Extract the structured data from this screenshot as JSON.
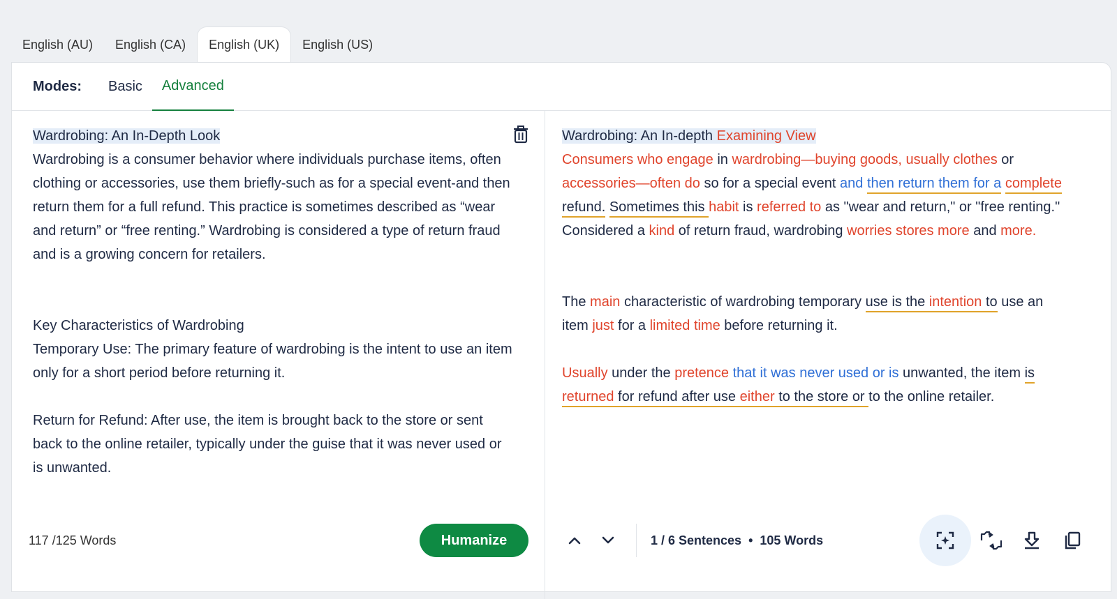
{
  "lang_tabs": [
    {
      "label": "English (AU)"
    },
    {
      "label": "English (CA)"
    },
    {
      "label": "English (UK)",
      "active": true
    },
    {
      "label": "English (US)"
    }
  ],
  "modes": {
    "label": "Modes:",
    "items": [
      {
        "label": "Basic"
      },
      {
        "label": "Advanced",
        "active": true
      }
    ]
  },
  "left": {
    "title": "Wardrobing: An In-Depth Look",
    "para1": "Wardrobing is a consumer behavior where individuals purchase items, often clothing or accessories, use them briefly-such as for a special event-and then return them for a full refund. This practice is sometimes described as “wear and return” or “free renting.” Wardrobing is considered a type of return fraud and is a growing concern for retailers.",
    "heading2": "Key Characteristics of Wardrobing",
    "para2": "Temporary Use: The primary feature of wardrobing is the intent to use an item only for a short period before returning it.",
    "para3": "Return for Refund: After use, the item is brought back to the store or sent back to the online retailer, typically under the guise that it was never used or is unwanted.",
    "word_count": "117 /125 Words",
    "humanize_label": "Humanize"
  },
  "right": {
    "title_a": "Wardrobing: An In-depth ",
    "title_b": "Examining View",
    "p1": [
      {
        "t": "Consumers who engage",
        "c": "red"
      },
      {
        "t": " in ",
        "c": ""
      },
      {
        "t": "wardrobing—buying goods, usually clothes",
        "c": "red"
      },
      {
        "t": " or ",
        "c": ""
      },
      {
        "t": "accessories—often do",
        "c": "red"
      },
      {
        "t": " so for a special event ",
        "c": ""
      },
      {
        "t": "and ",
        "c": "blue"
      },
      {
        "t": "then return them for a",
        "c": "blue ul"
      },
      {
        "t": " ",
        "c": ""
      },
      {
        "t": "complete",
        "c": "red ul"
      },
      {
        "t": " refund.",
        "c": "ul"
      },
      {
        "t": " ",
        "c": ""
      },
      {
        "t": "Sometimes this ",
        "c": "ul"
      },
      {
        "t": "habit",
        "c": "red"
      },
      {
        "t": " is ",
        "c": ""
      },
      {
        "t": "referred to",
        "c": "red"
      },
      {
        "t": " as \"wear and return,\" or \"free renting.\" Considered a ",
        "c": ""
      },
      {
        "t": "kind",
        "c": "red"
      },
      {
        "t": " of return fraud, wardrobing ",
        "c": ""
      },
      {
        "t": "worries stores more",
        "c": "red"
      },
      {
        "t": " and ",
        "c": ""
      },
      {
        "t": "more.",
        "c": "red"
      }
    ],
    "p2": [
      {
        "t": "The ",
        "c": ""
      },
      {
        "t": "main",
        "c": "red"
      },
      {
        "t": " characteristic of wardrobing temporary ",
        "c": ""
      },
      {
        "t": "use is the ",
        "c": "ul"
      },
      {
        "t": "intention",
        "c": "red ul"
      },
      {
        "t": " to",
        "c": "ul"
      },
      {
        "t": " use an item ",
        "c": ""
      },
      {
        "t": "just",
        "c": "red"
      },
      {
        "t": " for a ",
        "c": ""
      },
      {
        "t": "limited time",
        "c": "red"
      },
      {
        "t": " before returning it.",
        "c": ""
      }
    ],
    "p3": [
      {
        "t": "Usually",
        "c": "red"
      },
      {
        "t": " under the ",
        "c": ""
      },
      {
        "t": "pretence",
        "c": "red"
      },
      {
        "t": " ",
        "c": ""
      },
      {
        "t": "that it was never used or is",
        "c": "blue"
      },
      {
        "t": " unwanted, the item ",
        "c": ""
      },
      {
        "t": "is",
        "c": "ul"
      },
      {
        "t": " ",
        "c": ""
      },
      {
        "t": "returned",
        "c": "red ul"
      },
      {
        "t": " for refund after use ",
        "c": "ul"
      },
      {
        "t": "either",
        "c": "red ul"
      },
      {
        "t": " to the store or ",
        "c": "ul"
      },
      {
        "t": "to the online retailer.",
        "c": ""
      }
    ],
    "sentences": "1 / 6 Sentences",
    "dot": "•",
    "words": "105 Words"
  }
}
